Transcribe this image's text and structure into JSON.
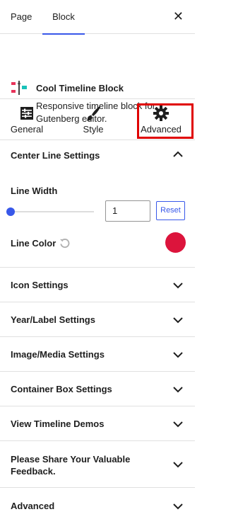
{
  "tabs": {
    "page": "Page",
    "block": "Block"
  },
  "block": {
    "title": "Cool Timeline Block",
    "description": "Responsive timeline block for Gutenberg editor."
  },
  "subtabs": {
    "general": "General",
    "style": "Style",
    "advanced": "Advanced"
  },
  "center_line": {
    "title": "Center Line Settings",
    "line_width_label": "Line Width",
    "line_width_value": "1",
    "reset_label": "Reset",
    "line_color_label": "Line Color",
    "line_color": "#dc143c"
  },
  "panels": [
    {
      "title": "Icon Settings"
    },
    {
      "title": "Year/Label Settings"
    },
    {
      "title": "Image/Media Settings"
    },
    {
      "title": "Container Box Settings"
    },
    {
      "title": "View Timeline Demos"
    },
    {
      "title": "Please Share Your Valuable Feedback."
    },
    {
      "title": "Advanced"
    }
  ],
  "colors": {
    "accent": "#3858e9",
    "highlight_box": "#e00000"
  }
}
